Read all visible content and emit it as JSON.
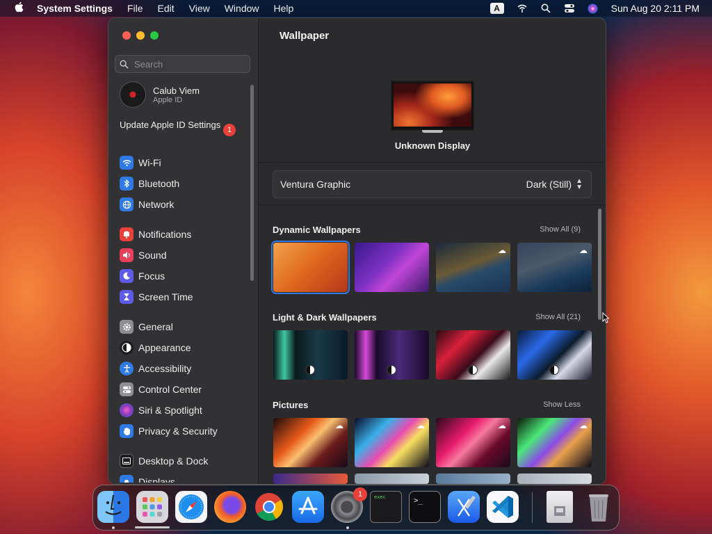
{
  "menubar": {
    "app_name": "System Settings",
    "menus": [
      "File",
      "Edit",
      "View",
      "Window",
      "Help"
    ],
    "input_source": "A",
    "datetime": "Sun Aug 20  2:11 PM"
  },
  "sidebar": {
    "search_placeholder": "Search",
    "account": {
      "name": "Calub Viem",
      "subtitle": "Apple ID"
    },
    "update": {
      "label": "Update Apple ID Settings",
      "badge": "1"
    },
    "items": [
      {
        "label": "Wi-Fi",
        "icon": "wifi-icon",
        "color": "#2f7ae5"
      },
      {
        "label": "Bluetooth",
        "icon": "bluetooth-icon",
        "color": "#2f7ae5"
      },
      {
        "label": "Network",
        "icon": "globe-icon",
        "color": "#2f7ae5"
      },
      {
        "label": "Notifications",
        "icon": "bell-icon",
        "color": "#e9403a"
      },
      {
        "label": "Sound",
        "icon": "speaker-icon",
        "color": "#e9405a"
      },
      {
        "label": "Focus",
        "icon": "moon-icon",
        "color": "#5e5ce6"
      },
      {
        "label": "Screen Time",
        "icon": "hourglass-icon",
        "color": "#5e5ce6"
      },
      {
        "label": "General",
        "icon": "gear-icon",
        "color": "#8e8e93"
      },
      {
        "label": "Appearance",
        "icon": "appearance-icon",
        "color": "#1c1c1e"
      },
      {
        "label": "Accessibility",
        "icon": "accessibility-icon",
        "color": "#2f7ae5"
      },
      {
        "label": "Control Center",
        "icon": "control-center-icon",
        "color": "#8e8e93"
      },
      {
        "label": "Siri & Spotlight",
        "icon": "siri-icon",
        "color": "#8a3ab9"
      },
      {
        "label": "Privacy & Security",
        "icon": "hand-icon",
        "color": "#2f7ae5"
      },
      {
        "label": "Desktop & Dock",
        "icon": "dock-icon",
        "color": "#1c1c1e"
      },
      {
        "label": "Displays",
        "icon": "display-icon",
        "color": "#2f7ae5"
      }
    ]
  },
  "main": {
    "title": "Wallpaper",
    "display_name": "Unknown Display",
    "current_wallpaper": "Ventura Graphic",
    "current_mode": "Dark (Still)",
    "sections": [
      {
        "title": "Dynamic Wallpapers",
        "action": "Show All (9)"
      },
      {
        "title": "Light & Dark Wallpapers",
        "action": "Show All (21)"
      },
      {
        "title": "Pictures",
        "action": "Show Less"
      }
    ]
  },
  "dock": {
    "apps": [
      "Finder",
      "Launchpad",
      "Safari",
      "Firefox",
      "Chrome",
      "App Store",
      "System Settings",
      "Script Editor",
      "Terminal",
      "Xcode",
      "Visual Studio Code",
      "Files",
      "Trash"
    ],
    "settings_badge": "1",
    "exec_label": "exec"
  }
}
